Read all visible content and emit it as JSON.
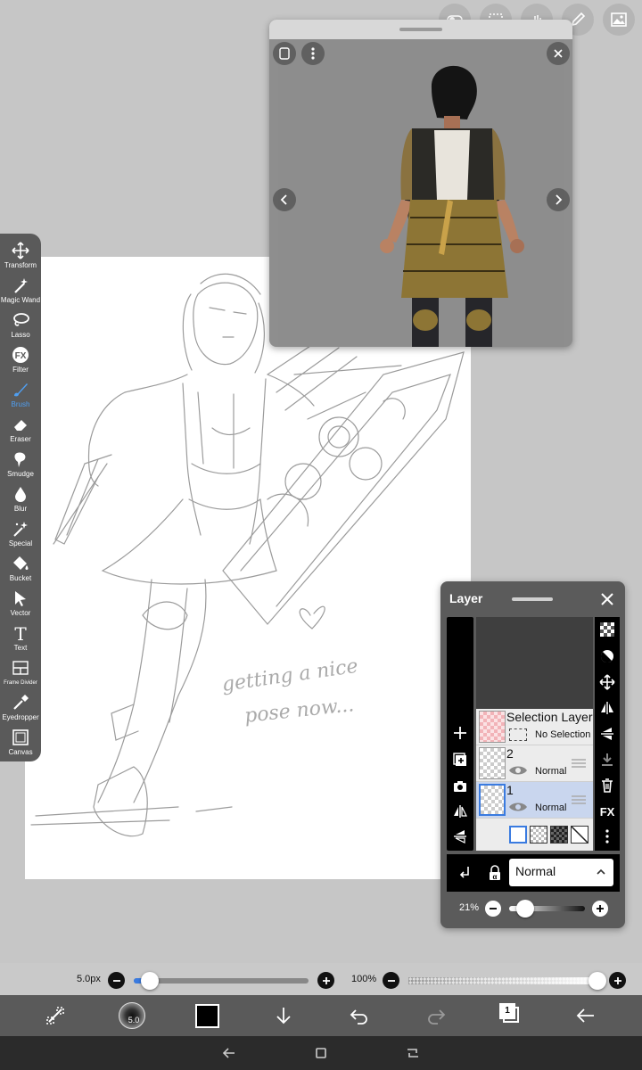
{
  "top_toolbar": {
    "icons": [
      "toggle-icon",
      "selection-frame-icon",
      "hand-tap-icon",
      "pen-edit-icon",
      "image-reference-icon"
    ]
  },
  "tools": [
    {
      "label": "Transform",
      "icon": "move-arrows-icon"
    },
    {
      "label": "Magic Wand",
      "icon": "magic-wand-icon"
    },
    {
      "label": "Lasso",
      "icon": "lasso-icon"
    },
    {
      "label": "Filter",
      "icon": "fx-icon",
      "glyph": "FX"
    },
    {
      "label": "Brush",
      "icon": "brush-icon",
      "active": true
    },
    {
      "label": "Eraser",
      "icon": "eraser-icon"
    },
    {
      "label": "Smudge",
      "icon": "smudge-icon"
    },
    {
      "label": "Blur",
      "icon": "drop-icon"
    },
    {
      "label": "Special",
      "icon": "sparkle-pen-icon"
    },
    {
      "label": "Bucket",
      "icon": "bucket-icon"
    },
    {
      "label": "Vector",
      "icon": "cursor-icon"
    },
    {
      "label": "Text",
      "icon": "text-icon",
      "glyph": "T"
    },
    {
      "label": "Frame Divider",
      "icon": "frame-divider-icon"
    },
    {
      "label": "Eyedropper",
      "icon": "eyedropper-icon"
    },
    {
      "label": "Canvas",
      "icon": "canvas-icon"
    }
  ],
  "canvas": {
    "handwriting_line1": "getting a nice",
    "handwriting_line2": "pose now..."
  },
  "layer_panel": {
    "title": "Layer",
    "selection_layer": {
      "name": "Selection Layer",
      "status": "No Selection"
    },
    "layers": [
      {
        "name": "2",
        "blend": "Normal",
        "selected": false
      },
      {
        "name": "1",
        "blend": "Normal",
        "selected": true
      }
    ],
    "blend_mode": "Normal",
    "opacity_label": "21%",
    "opacity_fraction": 0.21,
    "right_fx": "FX"
  },
  "bottom_sliders": {
    "size_label": "5.0px",
    "size_fraction": 0.09,
    "opacity_label": "100%",
    "opacity_fraction": 1.0
  },
  "bottom_bar": {
    "brush_size_badge": "5.0",
    "primary_color": "#000000",
    "layer_count": "1"
  },
  "colors": {
    "accent": "#3a7be0",
    "panel": "#5b5b5b",
    "toolbar": "#5a5a5a"
  }
}
